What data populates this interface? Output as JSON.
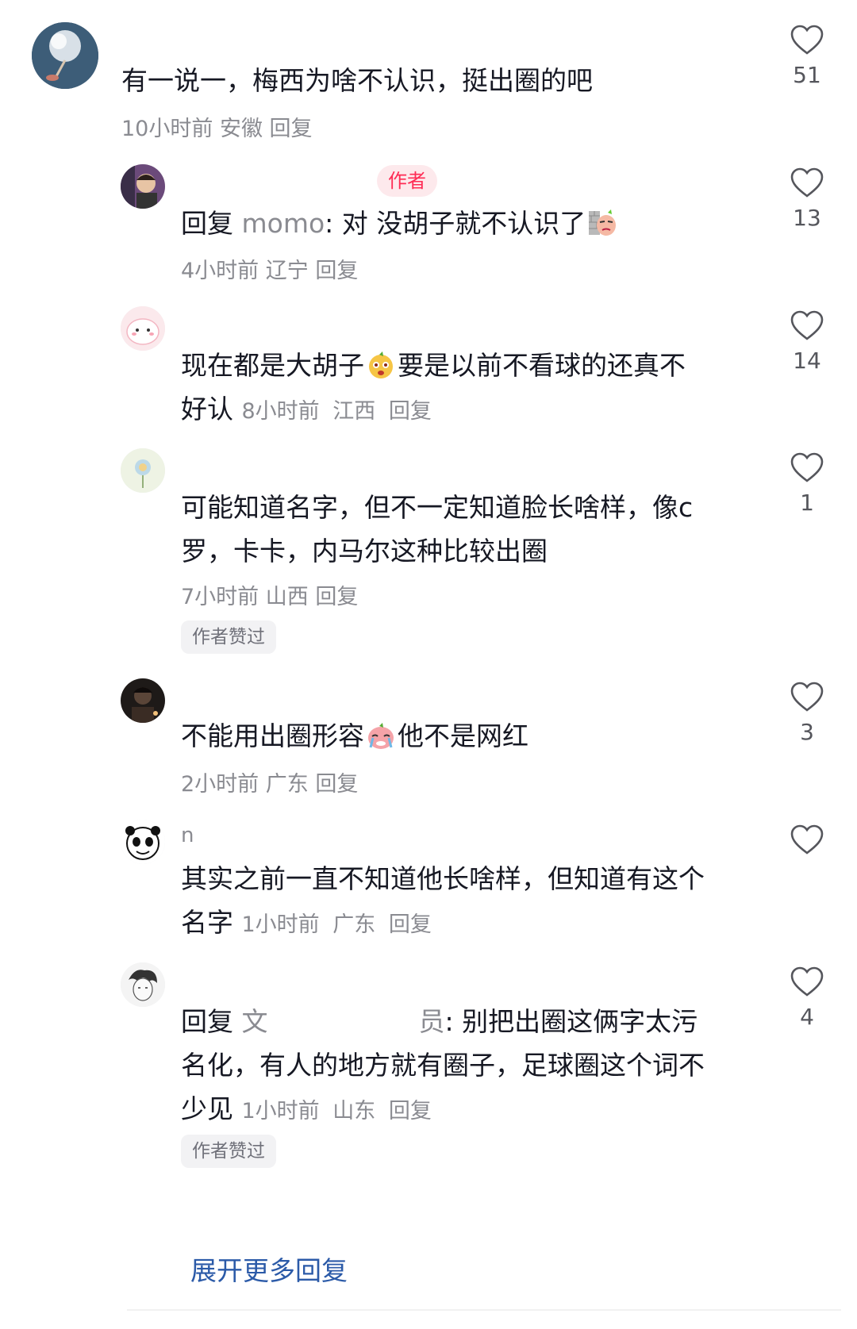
{
  "comments": [
    {
      "username": "",
      "text": "有一说一，梅西为啥不认识，挺出圈的吧",
      "meta": {
        "time": "10小时前",
        "location": "安徽",
        "reply": "回复"
      },
      "likes": "51"
    },
    {
      "username": "",
      "author_badge": "作者",
      "reply_prefix": "回复",
      "reply_to": "momo",
      "text": ": 对 没胡子就不认识了",
      "emoji": "smirk-wall-emoji",
      "meta": {
        "time": "4小时前",
        "location": "辽宁",
        "reply": "回复"
      },
      "likes": "13"
    },
    {
      "username": "",
      "text_before": "现在都是大胡子",
      "emoji": "shocked-face-emoji",
      "text_after": "要是以前不看球的还真不好认",
      "meta": {
        "time": "8小时前",
        "location": "江西",
        "reply": "回复"
      },
      "likes": "14"
    },
    {
      "username": "",
      "text": "可能知道名字，但不一定知道脸长啥样，像c罗，卡卡，内马尔这种比较出圈",
      "meta": {
        "time": "7小时前",
        "location": "山西",
        "reply": "回复"
      },
      "chip": "作者赞过",
      "likes": "1"
    },
    {
      "username": "",
      "text_before": "不能用出圈形容",
      "emoji": "crying-face-emoji",
      "text_after": "他不是网红",
      "meta": {
        "time": "2小时前",
        "location": "广东",
        "reply": "回复"
      },
      "likes": "3"
    },
    {
      "username": "n",
      "text": "其实之前一直不知道他长啥样，但知道有这个名字",
      "meta": {
        "time": "1小时前",
        "location": "广东",
        "reply": "回复"
      },
      "likes": ""
    },
    {
      "username": "",
      "reply_prefix": "回复",
      "reply_to": "文",
      "reply_to_tail": "员",
      "text": ": 别把出圈这俩字太污名化，有人的地方就有圈子，足球圈这个词不少见",
      "meta": {
        "time": "1小时前",
        "location": "山东",
        "reply": "回复"
      },
      "chip": "作者赞过",
      "likes": "4"
    }
  ],
  "more_replies": "展开更多回复",
  "colors": {
    "accent": "#fe2c55",
    "link": "#2b5aa8",
    "meta": "#8a8b91",
    "text": "#161823"
  }
}
